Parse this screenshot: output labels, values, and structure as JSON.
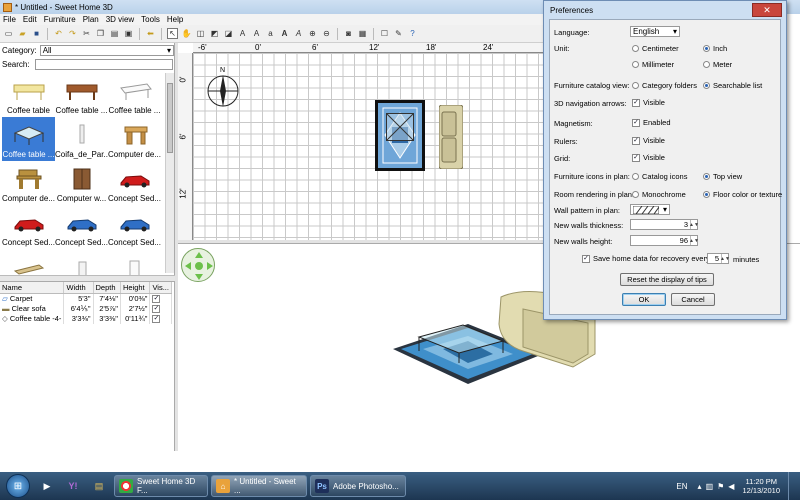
{
  "window": {
    "title": "* Untitled - Sweet Home 3D"
  },
  "menu": [
    "File",
    "Edit",
    "Furniture",
    "Plan",
    "3D view",
    "Tools",
    "Help"
  ],
  "catalog": {
    "category_label": "Category:",
    "category_value": "All",
    "search_label": "Search:",
    "search_value": "",
    "items": [
      {
        "label": "Coffee table",
        "icon": "coffee-table-icon"
      },
      {
        "label": "Coffee table ...",
        "icon": "wood-table-icon"
      },
      {
        "label": "Coffee table ...",
        "icon": "white-table-icon"
      },
      {
        "label": "Coffee table ...",
        "icon": "glass-table-icon",
        "selected": true
      },
      {
        "label": "Coifa_de_Par...",
        "icon": "hood-icon"
      },
      {
        "label": "Computer de...",
        "icon": "desk-icon"
      },
      {
        "label": "Computer de...",
        "icon": "computer-desk-icon"
      },
      {
        "label": "Computer w...",
        "icon": "wardrobe-icon"
      },
      {
        "label": "Concept Sed...",
        "icon": "red-car-icon"
      },
      {
        "label": "Concept Sed...",
        "icon": "red-car-icon"
      },
      {
        "label": "Concept Sed...",
        "icon": "blue-car-icon"
      },
      {
        "label": "Concept Sed...",
        "icon": "blue-car-icon"
      },
      {
        "label": "",
        "icon": "bench-icon"
      },
      {
        "label": "",
        "icon": "cylinder-icon"
      },
      {
        "label": "",
        "icon": "column-icon"
      }
    ]
  },
  "furniture_table": {
    "headers": [
      "Name",
      "Width",
      "Depth",
      "Height",
      "Vis..."
    ],
    "rows": [
      {
        "name": "Carpet",
        "width": "5'3\"",
        "depth": "7'4⅛\"",
        "height": "0'0⅜\"",
        "visible": true
      },
      {
        "name": "Clear sofa",
        "width": "6'4⅕\"",
        "depth": "2'5⅞\"",
        "height": "2'7½\"",
        "visible": true
      },
      {
        "name": "Coffee table -4-",
        "width": "3'3⅜\"",
        "depth": "3'3⅜\"",
        "height": "0'11¾\"",
        "visible": true
      }
    ]
  },
  "plan": {
    "ruler_h": [
      "-6'",
      "0'",
      "6'",
      "12'",
      "18'",
      "24'"
    ],
    "ruler_v": [
      "0'",
      "6'",
      "12'"
    ],
    "compass_label": "N"
  },
  "preferences": {
    "title": "Preferences",
    "language_label": "Language:",
    "language_value": "English",
    "unit_label": "Unit:",
    "unit_options": [
      "Centimeter",
      "Inch",
      "Millimeter",
      "Meter"
    ],
    "unit_selected": "Inch",
    "catalog_view_label": "Furniture catalog view:",
    "catalog_view_options": [
      "Category folders",
      "Searchable list"
    ],
    "catalog_view_selected": "Searchable list",
    "nav_arrows_label": "3D navigation arrows:",
    "nav_arrows_check": "Visible",
    "magnetism_label": "Magnetism:",
    "magnetism_check": "Enabled",
    "rulers_label": "Rulers:",
    "rulers_check": "Visible",
    "grid_label": "Grid:",
    "grid_check": "Visible",
    "icons_label": "Furniture icons in plan:",
    "icons_options": [
      "Catalog icons",
      "Top view"
    ],
    "icons_selected": "Top view",
    "room_label": "Room rendering in plan:",
    "room_options": [
      "Monochrome",
      "Floor color or texture"
    ],
    "room_selected": "Floor color or texture",
    "wall_pattern_label": "Wall pattern in plan:",
    "thickness_label": "New walls thickness:",
    "thickness_value": "3",
    "height_label": "New walls height:",
    "height_value": "96",
    "recovery_label": "Save home data for recovery every:",
    "recovery_value": "5",
    "recovery_unit": "minutes",
    "reset_tips_button": "Reset the display of tips",
    "ok_button": "OK",
    "cancel_button": "Cancel"
  },
  "taskbar": {
    "tasks": [
      "Sweet Home 3D F...",
      "* Untitled - Sweet ...",
      "Adobe Photosho..."
    ],
    "language": "EN",
    "time": "11:20 PM",
    "date": "12/13/2010"
  },
  "colors": {
    "accent": "#3a7bd5",
    "title_bar": "#cfe0f2",
    "dialog_frame": "#cddff2",
    "taskbar": "#2a4a6b"
  }
}
